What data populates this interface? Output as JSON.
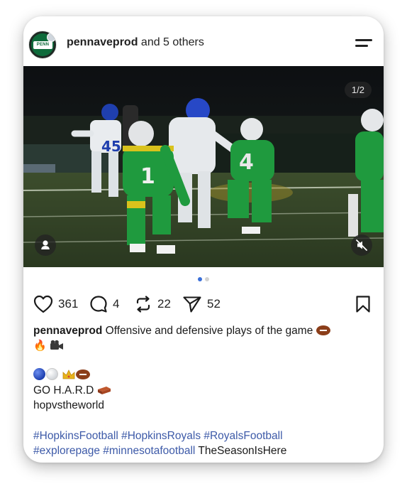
{
  "header": {
    "username": "pennaveprod",
    "collab_suffix": " and 5 others",
    "avatar_text": "PENN AVE"
  },
  "media": {
    "counter": "1/2",
    "pagination": {
      "current": 1,
      "total": 2
    },
    "jersey_numbers": {
      "center_player": "4",
      "left_player": "1",
      "white_player": "45"
    }
  },
  "actions": {
    "likes": "361",
    "comments": "4",
    "reposts": "22",
    "shares": "52"
  },
  "caption": {
    "username": "pennaveprod",
    "text": " Offensive and defensive plays of the game ",
    "line3_text": "GO H.A.R.D ",
    "line4_text": "hopvstheworld",
    "hashtags_line1": "#HopkinsFootball #HopkinsRoyals #RoyalsFootball",
    "hashtags_line2": "#explorepage #minnesotafootball",
    "line2_tail": " TheSeasonIsHere"
  },
  "emojis": {
    "caption_end": [
      "football",
      "fire",
      "movie-camera"
    ],
    "line_balls": [
      "blue-circle",
      "white-circle",
      "crown",
      "football"
    ],
    "line3_end": "brick"
  },
  "colors": {
    "hashtag": "#3d5aa8",
    "dot_active": "#3a6fd8",
    "dot_inactive": "#d2d2d2",
    "text": "#1a1a1a"
  }
}
